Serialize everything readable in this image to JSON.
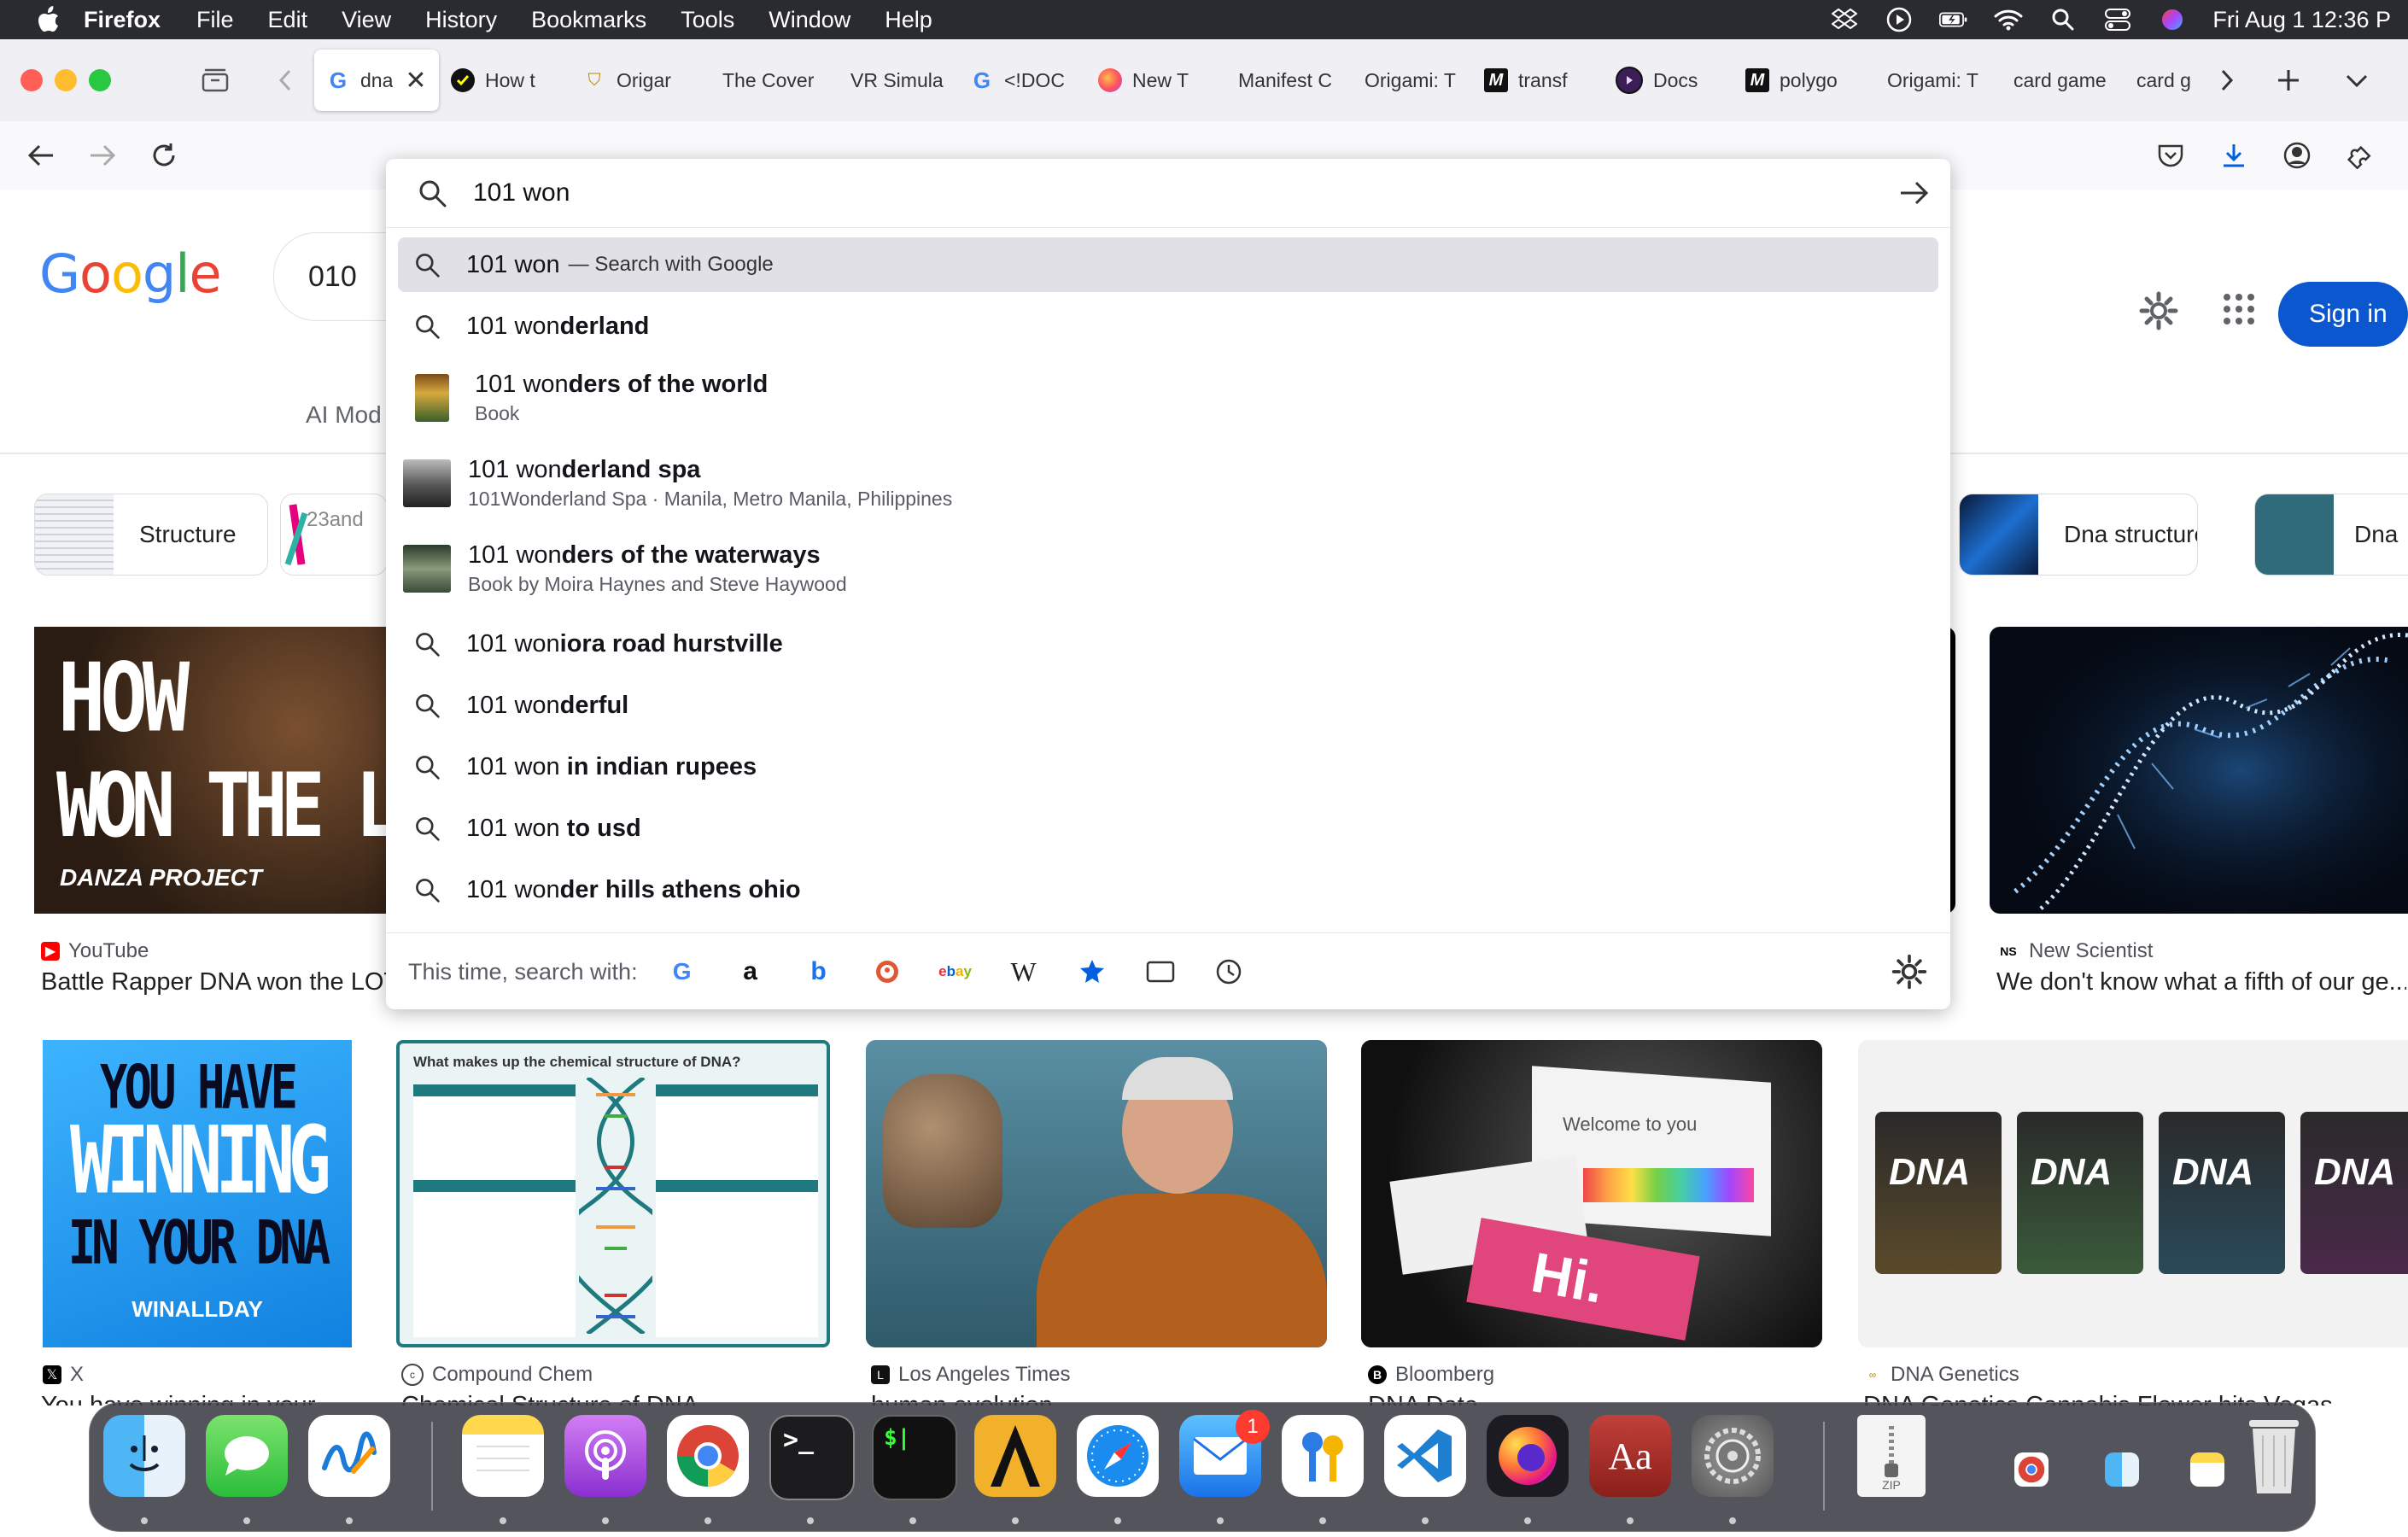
{
  "menubar": {
    "app": "Firefox",
    "items": [
      "File",
      "Edit",
      "View",
      "History",
      "Bookmarks",
      "Tools",
      "Window",
      "Help"
    ],
    "clock": "Fri Aug 1  12:36 P"
  },
  "tabs": [
    {
      "title": "dna",
      "icon": "google-icon",
      "active": true
    },
    {
      "title": "How t",
      "icon": "vercel-icon"
    },
    {
      "title": "Origar",
      "icon": "origami-icon"
    },
    {
      "title": "The Cover",
      "icon": "blank-icon"
    },
    {
      "title": "VR Simula",
      "icon": "blank-icon"
    },
    {
      "title": "<!DOC",
      "icon": "google-icon"
    },
    {
      "title": "New T",
      "icon": "firefox-icon"
    },
    {
      "title": "Manifest C",
      "icon": "blank-icon"
    },
    {
      "title": "Origami: T",
      "icon": "blank-icon"
    },
    {
      "title": "transf",
      "icon": "m-icon"
    },
    {
      "title": "Docs",
      "icon": "docs-icon"
    },
    {
      "title": "polygo",
      "icon": "m-icon"
    },
    {
      "title": "Origami: T",
      "icon": "blank-icon"
    },
    {
      "title": "card game",
      "icon": "blank-icon"
    },
    {
      "title": "card g",
      "icon": "blank-icon"
    }
  ],
  "urlbar": {
    "query": "101 won",
    "selected": {
      "typed": "101 won",
      "suffix": "— Search with Google"
    },
    "suggestions": [
      {
        "typed": "101 won",
        "rest": "derland",
        "kind": "search"
      },
      {
        "typed": "101 won",
        "rest": "ders of the world",
        "kind": "rich",
        "sub": "Book"
      },
      {
        "typed": "101 won",
        "rest": "derland spa",
        "kind": "rich",
        "sub": "101Wonderland Spa · Manila, Metro Manila, Philippines"
      },
      {
        "typed": "101 won",
        "rest": "ders of the waterways",
        "kind": "rich",
        "sub": "Book by Moira Haynes and Steve Haywood"
      },
      {
        "typed": "101 won",
        "rest": "iora road hurstville",
        "kind": "search"
      },
      {
        "typed": "101 won",
        "rest": "derful",
        "kind": "search"
      },
      {
        "typed": "101 won",
        "rest": " in indian rupees",
        "kind": "search"
      },
      {
        "typed": "101 won",
        "rest": " to usd",
        "kind": "search"
      },
      {
        "typed": "101 won",
        "rest": "der hills athens ohio",
        "kind": "search"
      }
    ],
    "engines_label": "This time, search with:",
    "engines": [
      "google-icon",
      "amazon-icon",
      "bing-icon",
      "duckduckgo-icon",
      "ebay-icon",
      "wikipedia-icon",
      "bookmarks-icon",
      "tabs-icon",
      "history-icon"
    ]
  },
  "google": {
    "logo": "Google",
    "search_value": "010",
    "ai_mode": "AI Mod",
    "sign_in": "Sign in",
    "chips": [
      {
        "label": "Structure"
      },
      {
        "label": "23and"
      },
      {
        "label": "Dna structure"
      },
      {
        "label": "Dna"
      }
    ],
    "row1": [
      {
        "source": "YouTube",
        "caption": "Battle Rapper DNA won the LOT"
      },
      {
        "source": "New Scientist",
        "caption": "We don't know what a fifth of our ge..."
      }
    ],
    "row1_thumb_text": {
      "line1": "HOW",
      "line2": "WON THE LOT",
      "badge": "DANZA PROJECT"
    },
    "row2": [
      {
        "source": "X",
        "caption": "You have winning in your ..."
      },
      {
        "source": "Compound Chem",
        "caption": "Chemical Structure of DNA ..."
      },
      {
        "source": "Los Angeles Times",
        "caption": "human evolution ..."
      },
      {
        "source": "Bloomberg",
        "caption": "DNA Data ..."
      },
      {
        "source": "DNA Genetics",
        "caption": "DNA Genetics Cannabis Flower hits Vegas ..."
      }
    ],
    "row2_thumb_text": {
      "winning": [
        "YOU HAVE",
        "WINNING",
        "IN YOUR DNA",
        "WINALLDAY"
      ],
      "compound": "What makes up the chemical structure of DNA?",
      "kit": [
        "Welcome to you",
        "Hi."
      ],
      "packs": [
        "DNA",
        "DNA",
        "DNA",
        "DNA"
      ]
    }
  },
  "dock": {
    "apps": [
      {
        "name": "finder"
      },
      {
        "name": "messages"
      },
      {
        "name": "freeform"
      },
      {
        "name": "notes"
      },
      {
        "name": "podcasts"
      },
      {
        "name": "chrome"
      },
      {
        "name": "terminal"
      },
      {
        "name": "terminal-dark"
      },
      {
        "name": "instruments"
      },
      {
        "name": "safari"
      },
      {
        "name": "mail",
        "badge": "1"
      },
      {
        "name": "passwords"
      },
      {
        "name": "vscode"
      },
      {
        "name": "firefox"
      },
      {
        "name": "dictionary",
        "label": "Aa"
      },
      {
        "name": "system-settings"
      }
    ],
    "zip_label": "ZIP"
  },
  "colors": {
    "accent": "#0b57d0",
    "menubar": "#2a2b30",
    "selected_row": "#e0e0e6"
  }
}
